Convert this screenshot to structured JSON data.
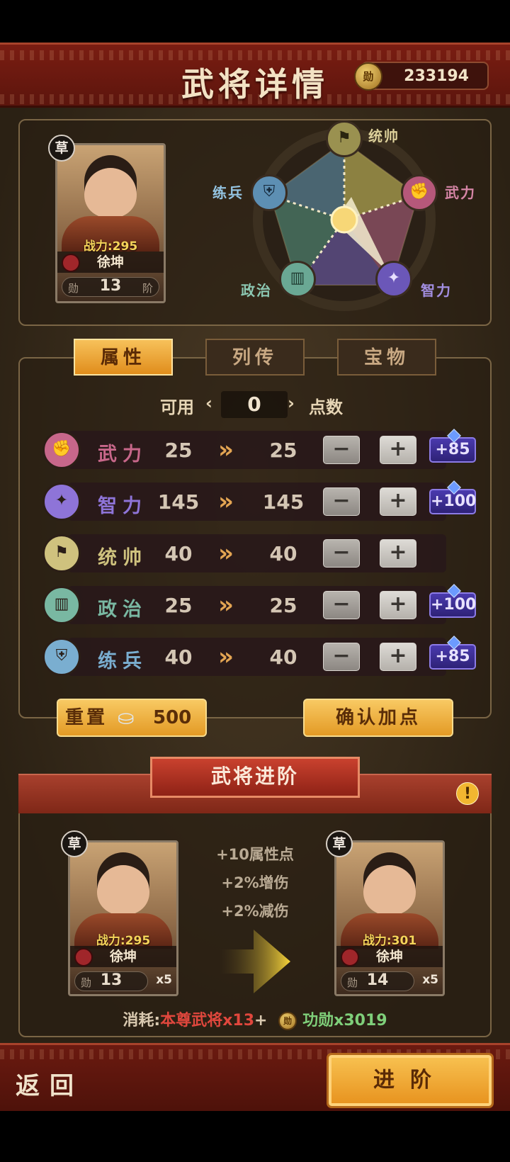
{
  "header": {
    "title": "武将详情",
    "currency_icon": "merit-coin-icon",
    "currency_value": "233194"
  },
  "general": {
    "quality_badge": "草",
    "power_label": "战力:",
    "power": "295",
    "name": "徐坤",
    "rank_left": "勋",
    "rank_level": "13",
    "rank_right": "阶"
  },
  "radar": {
    "leadership": "统帅",
    "strength": "武力",
    "intellect": "智力",
    "politics": "政治",
    "training": "练兵"
  },
  "tabs": {
    "attributes": "属性",
    "biography": "列传",
    "treasure": "宝物"
  },
  "points": {
    "label_left": "可用",
    "value": "0",
    "label_right": "点数"
  },
  "stats": [
    {
      "name": "武力",
      "current": "25",
      "next": "25",
      "bonus": "+85",
      "color": "#c7678a",
      "icon": "fist-icon"
    },
    {
      "name": "智力",
      "current": "145",
      "next": "145",
      "bonus": "+100",
      "color": "#8e74d8",
      "icon": "star-icon"
    },
    {
      "name": "统帅",
      "current": "40",
      "next": "40",
      "bonus": "",
      "color": "#cfc27e",
      "icon": "flag-icon"
    },
    {
      "name": "政治",
      "current": "25",
      "next": "25",
      "bonus": "+100",
      "color": "#79b8a2",
      "icon": "scroll-icon"
    },
    {
      "name": "练兵",
      "current": "40",
      "next": "40",
      "bonus": "+85",
      "color": "#7aaed0",
      "icon": "armor-icon"
    }
  ],
  "actions": {
    "reset_label": "重置",
    "reset_cost": "500",
    "confirm_label": "确认加点"
  },
  "advance": {
    "title": "武将进阶",
    "benefits": [
      "+10属性点",
      "+2%增伤",
      "+2%减伤"
    ],
    "before": {
      "badge": "草",
      "power_label": "战力:",
      "power": "295",
      "name": "徐坤",
      "rank_left": "勋",
      "level": "13",
      "rank_right": "阶",
      "count": "x5"
    },
    "after": {
      "badge": "草",
      "power_label": "战力:",
      "power": "301",
      "name": "徐坤",
      "rank_left": "勋",
      "level": "14",
      "rank_right": "阶",
      "count": "x5"
    },
    "cost_label": "消耗:",
    "cost_item": "本尊武将x13",
    "cost_plus": "+",
    "cost_merit": "功勋x3019"
  },
  "footer": {
    "back_label": "返回",
    "advance_label": "进阶"
  }
}
